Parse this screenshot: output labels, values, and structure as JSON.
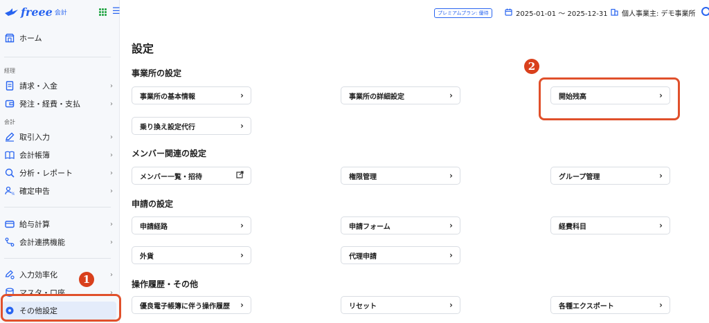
{
  "app": {
    "logo_text": "freee",
    "logo_sub": "会計"
  },
  "sidebar": {
    "home": "ホーム",
    "section_keiri": "経理",
    "seikyu": "請求・入金",
    "hacchu": "発注・経費・支払",
    "section_kaikei": "会計",
    "torihiki": "取引入力",
    "chobo": "会計帳簿",
    "bunseki": "分析・レポート",
    "kakutei": "確定申告",
    "kyuyo": "給与計算",
    "renkei": "会計連携機能",
    "koritsu": "入力効率化",
    "master": "マスタ・口座",
    "sonota": "その他設定"
  },
  "header": {
    "premium": "プレミアムプラン: 優待",
    "date_range": "2025-01-01 〜 2025-12-31",
    "office": "個人事業主: デモ事業所"
  },
  "callouts": {
    "one": "1",
    "two": "2"
  },
  "main": {
    "title": "設定",
    "sections": {
      "office": "事業所の設定",
      "member": "メンバー関連の設定",
      "request": "申請の設定",
      "history": "操作履歴・その他"
    },
    "cards": {
      "kihon": "事業所の基本情報",
      "shosai": "事業所の詳細設定",
      "zandaka": "開始残高",
      "norikae": "乗り換え設定代行",
      "member_list": "メンバー一覧・招待",
      "kengen": "権限管理",
      "group": "グループ管理",
      "keiro": "申請経路",
      "form": "申請フォーム",
      "keihi": "経費科目",
      "gaika": "外貨",
      "dairi": "代理申請",
      "rireki": "優良電子帳簿に伴う操作履歴",
      "reset": "リセット",
      "export": "各種エクスポート"
    }
  },
  "colors": {
    "accent": "#2864f0",
    "callout": "#e0502b",
    "badge": "#d9401c"
  }
}
